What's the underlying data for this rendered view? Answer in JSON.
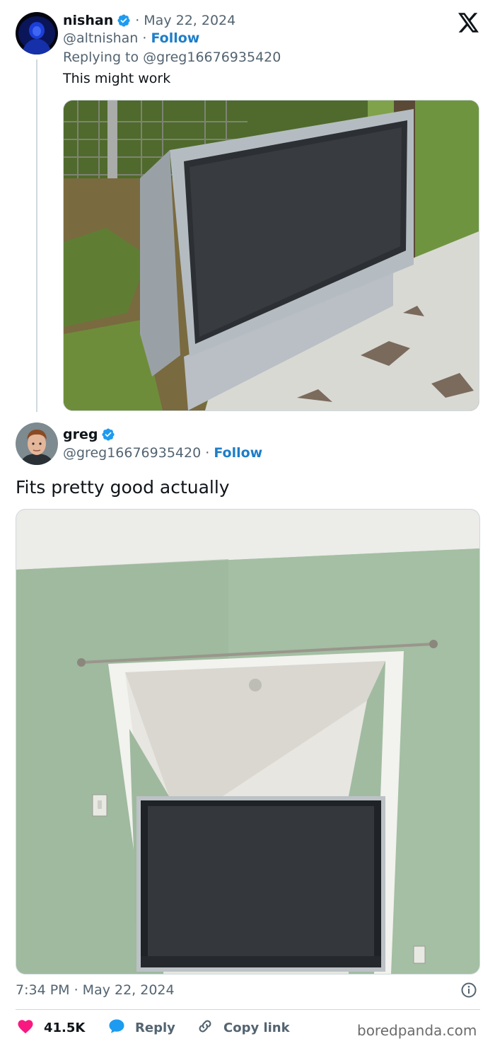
{
  "reply_tweet": {
    "name": "nishan",
    "date": "May 22, 2024",
    "handle": "@altnishan",
    "follow": "Follow",
    "replying_to": "Replying to @greg16676935420",
    "text": "This might work"
  },
  "main_tweet": {
    "name": "greg",
    "handle": "@greg16676935420",
    "follow": "Follow",
    "text": "Fits pretty good actually",
    "time": "7:34 PM · May 22, 2024"
  },
  "actions": {
    "likes": "41.5K",
    "reply": "Reply",
    "copy_link": "Copy link"
  },
  "watermark": "boredpanda.com",
  "icons": {
    "logo": "x-logo-icon",
    "verified": "verified-badge-icon",
    "info": "info-icon",
    "like": "heart-icon",
    "reply": "reply-bubble-icon",
    "link": "link-icon"
  },
  "colors": {
    "accent": "#1d9bf0",
    "link": "#1d7ec9",
    "like": "#f91880",
    "muted": "#536471"
  }
}
